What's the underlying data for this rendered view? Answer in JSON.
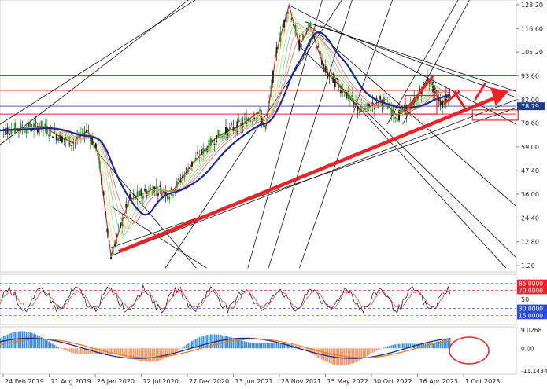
{
  "chart_data": [
    {
      "type": "candlestick",
      "panel": "price",
      "title": "",
      "y_ticks": [
        "128.20",
        "116.60",
        "105.20",
        "93.60",
        "82.00",
        "70.60",
        "59.00",
        "47.40",
        "36.00",
        "24.40",
        "12.80",
        "1.20"
      ],
      "current_price": "78.79",
      "ylim": [
        1.2,
        128.2
      ],
      "trend_points": [
        {
          "x": 0.0,
          "y": 67
        },
        {
          "x": 0.08,
          "y": 69
        },
        {
          "x": 0.14,
          "y": 61
        },
        {
          "x": 0.17,
          "y": 67
        },
        {
          "x": 0.19,
          "y": 56
        },
        {
          "x": 0.215,
          "y": 6
        },
        {
          "x": 0.25,
          "y": 33
        },
        {
          "x": 0.3,
          "y": 39
        },
        {
          "x": 0.33,
          "y": 36
        },
        {
          "x": 0.37,
          "y": 50
        },
        {
          "x": 0.42,
          "y": 64
        },
        {
          "x": 0.47,
          "y": 70
        },
        {
          "x": 0.5,
          "y": 76
        },
        {
          "x": 0.515,
          "y": 68
        },
        {
          "x": 0.535,
          "y": 105
        },
        {
          "x": 0.56,
          "y": 128
        },
        {
          "x": 0.58,
          "y": 108
        },
        {
          "x": 0.6,
          "y": 118
        },
        {
          "x": 0.63,
          "y": 96
        },
        {
          "x": 0.66,
          "y": 88
        },
        {
          "x": 0.7,
          "y": 76
        },
        {
          "x": 0.74,
          "y": 82
        },
        {
          "x": 0.77,
          "y": 74
        },
        {
          "x": 0.8,
          "y": 80
        },
        {
          "x": 0.83,
          "y": 92
        },
        {
          "x": 0.855,
          "y": 80
        },
        {
          "x": 0.87,
          "y": 84
        }
      ],
      "horizontal_levels": [
        93.6,
        86.5,
        78.79,
        75.0
      ],
      "annotation": "red arrows indicating projected upward move toward ~86"
    },
    {
      "type": "line",
      "panel": "oscillator",
      "name": "",
      "levels": [
        "85.0000",
        "70.0000",
        "30.0000",
        "15.0000"
      ],
      "middle_tick": "50",
      "ylim": [
        0,
        100
      ]
    },
    {
      "type": "bar",
      "panel": "macd",
      "levels": [
        "9.0268",
        "0.00",
        "-11.1434"
      ],
      "ylim": [
        -11.1434,
        9.0268
      ]
    }
  ],
  "x_ticks": [
    "24 Feb 2019",
    "11 Aug 2019",
    "26 Jan 2020",
    "12 Jul 2020",
    "27 Dec 2020",
    "13 Jun 2021",
    "28 Nov 2021",
    "15 May 2022",
    "30 Oct 2022",
    "16 Apr 2023",
    "1 Oct 2023"
  ],
  "colors": {
    "up_candle": "#2e8b2e",
    "down_candle": "#222222",
    "red_line": "#e8242a",
    "blue_ma": "#1d2a8c",
    "price_tag_bg": "#1e3a8a",
    "level_red_bg": "#e8242a",
    "level_blue_bg": "#2b4bd6",
    "hist_up": "#3d8fe0",
    "hist_down": "#f29a6a",
    "signal": "#f07c1b"
  }
}
